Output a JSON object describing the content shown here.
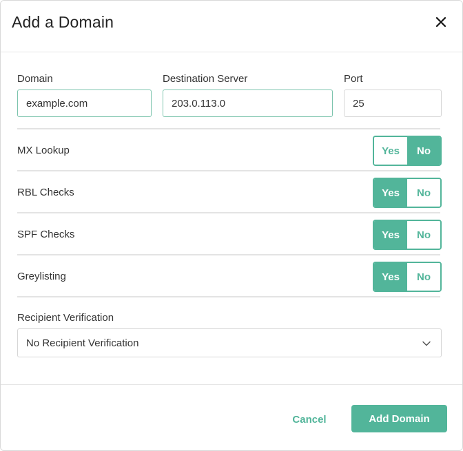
{
  "dialog": {
    "title": "Add a Domain",
    "close_icon": "close-icon"
  },
  "fields": {
    "domain": {
      "label": "Domain",
      "value": "example.com"
    },
    "destination": {
      "label": "Destination Server",
      "value": "203.0.113.0"
    },
    "port": {
      "label": "Port",
      "value": "25"
    }
  },
  "options": [
    {
      "label": "MX Lookup",
      "yes_label": "Yes",
      "no_label": "No",
      "selected": "No"
    },
    {
      "label": "RBL Checks",
      "yes_label": "Yes",
      "no_label": "No",
      "selected": "Yes"
    },
    {
      "label": "SPF Checks",
      "yes_label": "Yes",
      "no_label": "No",
      "selected": "Yes"
    },
    {
      "label": "Greylisting",
      "yes_label": "Yes",
      "no_label": "No",
      "selected": "Yes"
    }
  ],
  "recipient_verification": {
    "label": "Recipient Verification",
    "selected": "No Recipient Verification",
    "chevron_icon": "chevron-down-icon"
  },
  "footer": {
    "cancel_label": "Cancel",
    "submit_label": "Add Domain"
  },
  "colors": {
    "accent": "#52b59a",
    "focus_border": "#7cc4ad",
    "divider": "#e3e3e3"
  }
}
